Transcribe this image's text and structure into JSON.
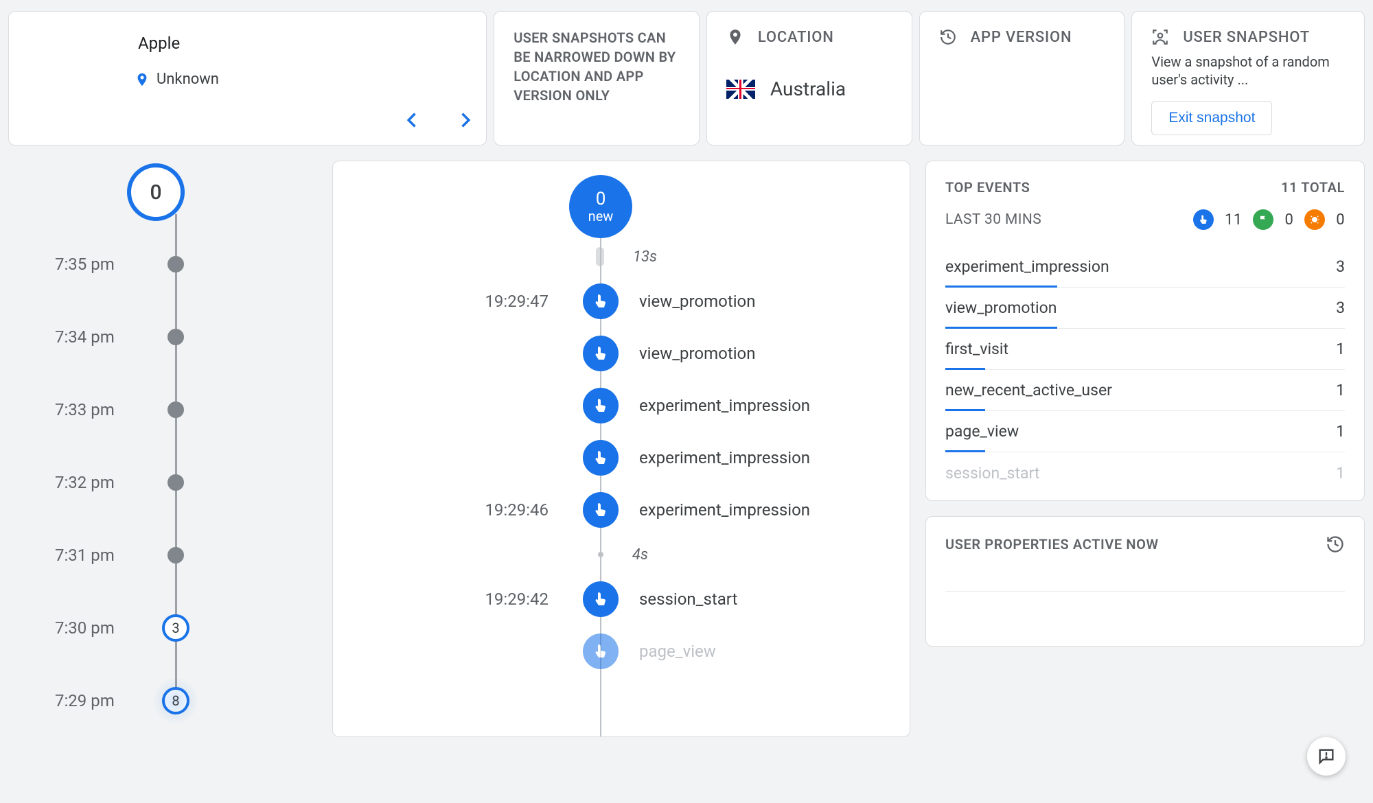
{
  "device": {
    "brand": "Apple",
    "location_label": "Unknown"
  },
  "note": "USER SNAPSHOTS CAN BE NARROWED DOWN BY LOCATION AND APP VERSION ONLY",
  "location": {
    "header": "LOCATION",
    "country": "Australia"
  },
  "app_version": {
    "header": "APP VERSION"
  },
  "snapshot": {
    "header": "USER SNAPSHOT",
    "desc": "View a snapshot of a random user's activity ...",
    "exit_label": "Exit snapshot"
  },
  "timeline": {
    "current_badge": "0",
    "rows": [
      {
        "time": "7:35 pm",
        "type": "dot"
      },
      {
        "time": "7:34 pm",
        "type": "dot"
      },
      {
        "time": "7:33 pm",
        "type": "dot"
      },
      {
        "time": "7:32 pm",
        "type": "dot"
      },
      {
        "time": "7:31 pm",
        "type": "dot"
      },
      {
        "time": "7:30 pm",
        "type": "ring",
        "value": "3"
      },
      {
        "time": "7:29 pm",
        "type": "ring_glow",
        "value": "8"
      }
    ]
  },
  "events": {
    "head_value": "0",
    "head_sub": "new",
    "rows": [
      {
        "kind": "gap",
        "pill": true,
        "duration": "13s"
      },
      {
        "kind": "event",
        "ts": "19:29:47",
        "name": "view_promotion"
      },
      {
        "kind": "event",
        "name": "view_promotion"
      },
      {
        "kind": "event",
        "name": "experiment_impression"
      },
      {
        "kind": "event",
        "name": "experiment_impression"
      },
      {
        "kind": "event",
        "ts": "19:29:46",
        "name": "experiment_impression"
      },
      {
        "kind": "gap",
        "tiny": true,
        "duration": "4s"
      },
      {
        "kind": "event",
        "ts": "19:29:42",
        "name": "session_start"
      },
      {
        "kind": "event_faded",
        "name": "page_view"
      }
    ]
  },
  "top_events": {
    "header": "TOP EVENTS",
    "total_label": "11 TOTAL",
    "sub_label": "LAST 30 MINS",
    "badge_counts": {
      "touch": "11",
      "flag": "0",
      "bug": "0"
    },
    "items": [
      {
        "name": "experiment_impression",
        "count": "3",
        "bar": 28
      },
      {
        "name": "view_promotion",
        "count": "3",
        "bar": 28
      },
      {
        "name": "first_visit",
        "count": "1",
        "bar": 10
      },
      {
        "name": "new_recent_active_user",
        "count": "1",
        "bar": 10
      },
      {
        "name": "page_view",
        "count": "1",
        "bar": 10
      },
      {
        "name": "session_start",
        "count": "1",
        "faded": true
      }
    ]
  },
  "user_props": {
    "header": "USER PROPERTIES ACTIVE NOW"
  }
}
